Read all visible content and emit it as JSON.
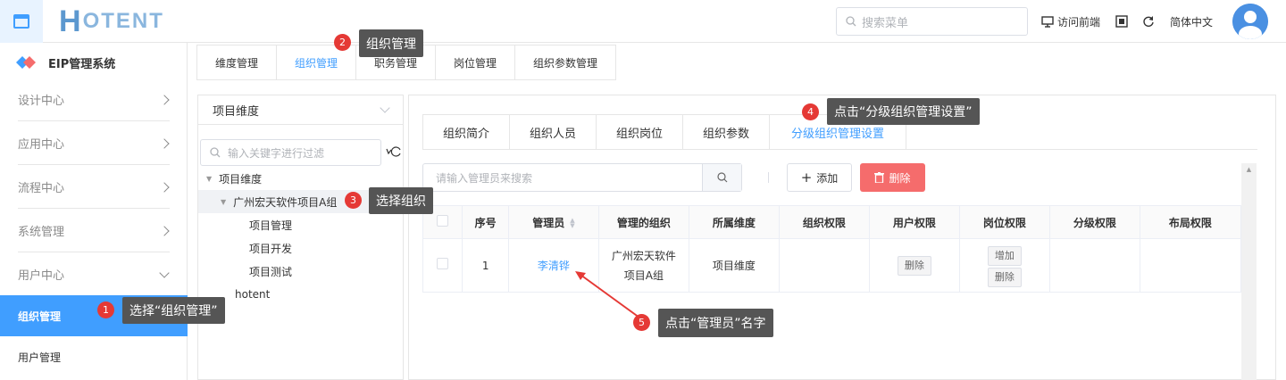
{
  "header": {
    "logo_h": "H",
    "logo_rest": "OTENT",
    "search_placeholder": "搜索菜单",
    "visit_frontend": "访问前端",
    "language": "简体中文"
  },
  "sidebar": {
    "title": "EIP管理系统",
    "items": [
      {
        "label": "设计中心"
      },
      {
        "label": "应用中心"
      },
      {
        "label": "流程中心"
      },
      {
        "label": "系统管理"
      },
      {
        "label": "用户中心"
      }
    ],
    "sub_items": [
      {
        "label": "组织管理",
        "active": true
      },
      {
        "label": "用户管理"
      }
    ]
  },
  "top_tabs": [
    {
      "label": "维度管理"
    },
    {
      "label": "组织管理",
      "active": true
    },
    {
      "label": "职务管理"
    },
    {
      "label": "岗位管理"
    },
    {
      "label": "组织参数管理"
    }
  ],
  "tree": {
    "dimension_select": "项目维度",
    "filter_placeholder": "输入关键字进行过滤",
    "nodes": [
      {
        "label": "项目维度"
      },
      {
        "label": "广州宏天软件项目A组"
      },
      {
        "label": "项目管理"
      },
      {
        "label": "项目开发"
      },
      {
        "label": "项目测试"
      },
      {
        "label": "hotent"
      }
    ]
  },
  "sub_tabs": [
    {
      "label": "组织简介"
    },
    {
      "label": "组织人员"
    },
    {
      "label": "组织岗位"
    },
    {
      "label": "组织参数"
    },
    {
      "label": "分级组织管理设置",
      "active": true
    }
  ],
  "toolbar": {
    "admin_search_placeholder": "请输入管理员来搜索",
    "add_label": "添加",
    "delete_label": "删除"
  },
  "table": {
    "headers": [
      "序号",
      "管理员",
      "管理的组织",
      "所属维度",
      "组织权限",
      "用户权限",
      "岗位权限",
      "分级权限",
      "布局权限"
    ],
    "rows": [
      {
        "index": "1",
        "admin": "李清铧",
        "org_line1": "广州宏天软件",
        "org_line2": "项目A组",
        "dimension": "项目维度",
        "user_perm_btn": "删除",
        "post_perm_add": "增加",
        "post_perm_del": "删除"
      }
    ]
  },
  "annotations": [
    {
      "num": "1",
      "text": "选择“组织管理”"
    },
    {
      "num": "2",
      "text": "组织管理"
    },
    {
      "num": "3",
      "text": "选择组织"
    },
    {
      "num": "4",
      "text": "点击“分级组织管理设置”"
    },
    {
      "num": "5",
      "text": "点击“管理员”名字"
    }
  ],
  "colors": {
    "accent": "#409eff",
    "danger": "#f56c6c",
    "annotation_bg": "#555555",
    "badge": "#e53935"
  }
}
